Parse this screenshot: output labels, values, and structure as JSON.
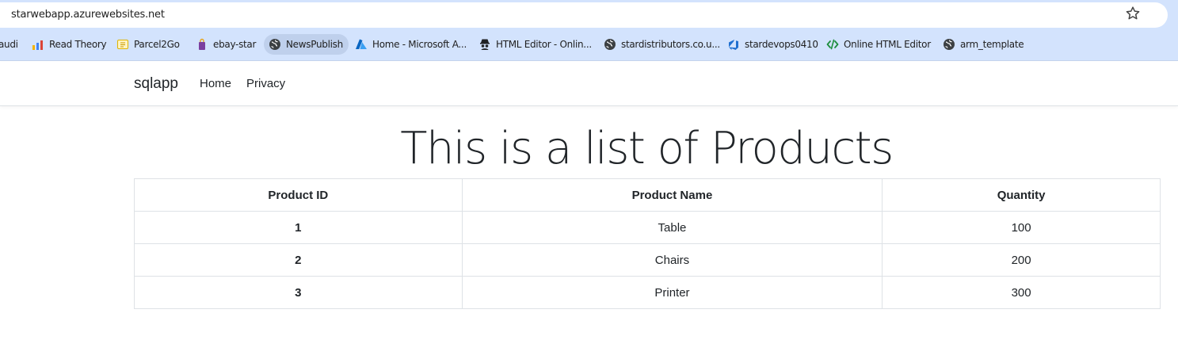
{
  "browser": {
    "url": "starwebapp.azurewebsites.net",
    "bookmarks": [
      {
        "label": "audi",
        "icon": "folder-icon"
      },
      {
        "label": "Read Theory",
        "icon": "chart-icon"
      },
      {
        "label": "Parcel2Go",
        "icon": "parcel-icon"
      },
      {
        "label": "ebay-star",
        "icon": "bag-icon"
      },
      {
        "label": "NewsPublish",
        "icon": "globe-icon"
      },
      {
        "label": "Home - Microsoft A...",
        "icon": "azure-icon"
      },
      {
        "label": "HTML Editor - Onlin...",
        "icon": "spy-icon"
      },
      {
        "label": "stardistributors.co.u...",
        "icon": "globe-icon"
      },
      {
        "label": "stardevops0410",
        "icon": "devops-icon"
      },
      {
        "label": "Online HTML Editor",
        "icon": "code-icon"
      },
      {
        "label": "arm_template",
        "icon": "globe-icon"
      }
    ]
  },
  "app": {
    "brand": "sqlapp",
    "nav": [
      "Home",
      "Privacy"
    ],
    "title": "This is a list of Products",
    "table": {
      "headers": [
        "Product ID",
        "Product Name",
        "Quantity"
      ],
      "rows": [
        [
          "1",
          "Table",
          "100"
        ],
        [
          "2",
          "Chairs",
          "200"
        ],
        [
          "3",
          "Printer",
          "300"
        ]
      ]
    }
  },
  "colors": {
    "chrome_bg": "#d3e3fd",
    "text": "#212529",
    "border": "#dee2e6"
  }
}
